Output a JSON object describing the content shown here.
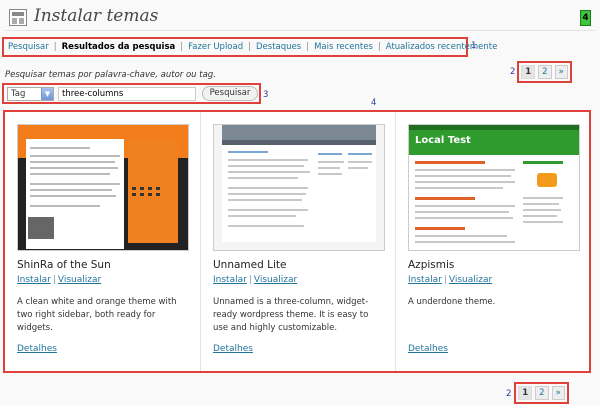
{
  "page": {
    "title": "Instalar temas",
    "green_badge": "4"
  },
  "submenu": {
    "items": [
      {
        "label": "Pesquisar",
        "current": false
      },
      {
        "label": "Resultados da pesquisa",
        "current": true
      },
      {
        "label": "Fazer Upload",
        "current": false
      },
      {
        "label": "Destaques",
        "current": false
      },
      {
        "label": "Mais recentes",
        "current": false
      },
      {
        "label": "Atualizados recentemente",
        "current": false
      }
    ],
    "annotation": "1"
  },
  "search": {
    "hint": "Pesquisar temas por palavra-chave, autor ou tag.",
    "type_value": "Tag",
    "query": "three-columns",
    "button_label": "Pesquisar",
    "annotation": "3"
  },
  "pagination_top": {
    "annotation": "2",
    "pages": [
      "1",
      "2"
    ],
    "next": "»"
  },
  "pagination_bottom": {
    "annotation": "2",
    "pages": [
      "1",
      "2"
    ],
    "next": "»"
  },
  "themes_annotation": "4",
  "themes": [
    {
      "name": "ShinRa of the Sun",
      "install": "Instalar",
      "preview": "Visualizar",
      "description": "A clean white and orange theme with two right sidebar, both ready for widgets.",
      "details": "Detalhes"
    },
    {
      "name": "Unnamed Lite",
      "install": "Instalar",
      "preview": "Visualizar",
      "description": "Unnamed is a three-column, widget-ready wordpress theme. It is easy to use and highly customizable.",
      "details": "Detalhes"
    },
    {
      "name": "Azpismis",
      "install": "Instalar",
      "preview": "Visualizar",
      "description": "A underdone theme.",
      "details": "Detalhes",
      "screenshot_title": "Local Test"
    }
  ],
  "colors": {
    "annotation_border": "#e0403a",
    "link": "#21759b",
    "badge": "#3ec43e"
  }
}
